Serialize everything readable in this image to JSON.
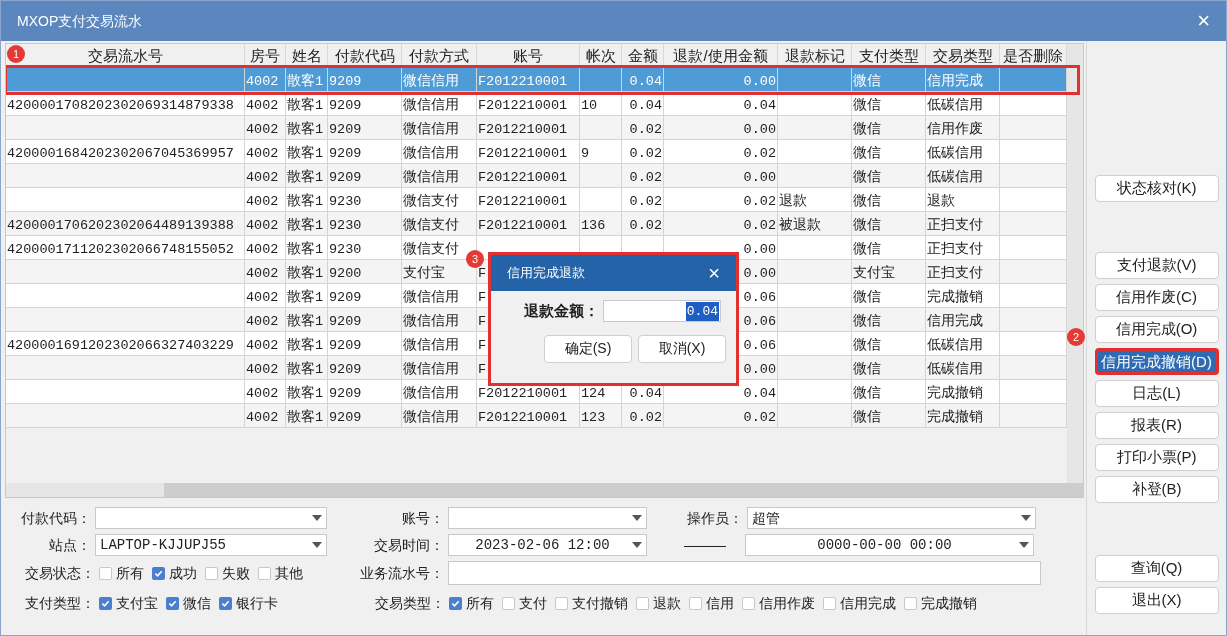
{
  "window": {
    "title": "MXOP支付交易流水",
    "close": "×"
  },
  "table": {
    "columns": [
      "交易流水号",
      "房号",
      "姓名",
      "付款代码",
      "付款方式",
      "账号",
      "帐次",
      "金额",
      "退款/使用金额",
      "退款标记",
      "支付类型",
      "交易类型",
      "是否删除"
    ],
    "rows": [
      {
        "selected": true,
        "cells": [
          "",
          "4002",
          "散客1",
          "9209",
          "微信信用",
          "F2012210001",
          "",
          "0.04",
          "0.00",
          "",
          "微信",
          "信用完成",
          ""
        ]
      },
      {
        "selected": false,
        "cells": [
          "4200001708202302069314879338",
          "4002",
          "散客1",
          "9209",
          "微信信用",
          "F2012210001",
          "10",
          "0.04",
          "0.04",
          "",
          "微信",
          "低碳信用",
          ""
        ]
      },
      {
        "selected": false,
        "cells": [
          "",
          "4002",
          "散客1",
          "9209",
          "微信信用",
          "F2012210001",
          "",
          "0.02",
          "0.00",
          "",
          "微信",
          "信用作废",
          ""
        ]
      },
      {
        "selected": false,
        "cells": [
          "4200001684202302067045369957",
          "4002",
          "散客1",
          "9209",
          "微信信用",
          "F2012210001",
          "9",
          "0.02",
          "0.02",
          "",
          "微信",
          "低碳信用",
          ""
        ]
      },
      {
        "selected": false,
        "cells": [
          "",
          "4002",
          "散客1",
          "9209",
          "微信信用",
          "F2012210001",
          "",
          "0.02",
          "0.00",
          "",
          "微信",
          "低碳信用",
          ""
        ]
      },
      {
        "selected": false,
        "cells": [
          "",
          "4002",
          "散客1",
          "9230",
          "微信支付",
          "F2012210001",
          "",
          "0.02",
          "0.02",
          "退款",
          "微信",
          "退款",
          ""
        ]
      },
      {
        "selected": false,
        "cells": [
          "4200001706202302064489139388",
          "4002",
          "散客1",
          "9230",
          "微信支付",
          "F2012210001",
          "136",
          "0.02",
          "0.02",
          "被退款",
          "微信",
          "正扫支付",
          ""
        ]
      },
      {
        "selected": false,
        "cells": [
          "4200001711202302066748155052",
          "4002",
          "散客1",
          "9230",
          "微信支付",
          "",
          "",
          "",
          "0.00",
          "",
          "微信",
          "正扫支付",
          ""
        ]
      },
      {
        "selected": false,
        "cells": [
          "",
          "4002",
          "散客1",
          "9200",
          "支付宝",
          "F",
          "",
          "",
          "0.00",
          "",
          "支付宝",
          "正扫支付",
          ""
        ]
      },
      {
        "selected": false,
        "cells": [
          "",
          "4002",
          "散客1",
          "9209",
          "微信信用",
          "F",
          "",
          "",
          "0.06",
          "",
          "微信",
          "完成撤销",
          ""
        ]
      },
      {
        "selected": false,
        "cells": [
          "",
          "4002",
          "散客1",
          "9209",
          "微信信用",
          "F",
          "",
          "",
          "0.06",
          "",
          "微信",
          "信用完成",
          ""
        ]
      },
      {
        "selected": false,
        "cells": [
          "4200001691202302066327403229",
          "4002",
          "散客1",
          "9209",
          "微信信用",
          "F",
          "",
          "",
          "0.06",
          "",
          "微信",
          "低碳信用",
          ""
        ]
      },
      {
        "selected": false,
        "cells": [
          "",
          "4002",
          "散客1",
          "9209",
          "微信信用",
          "F",
          "",
          "",
          "0.00",
          "",
          "微信",
          "低碳信用",
          ""
        ]
      },
      {
        "selected": false,
        "cells": [
          "",
          "4002",
          "散客1",
          "9209",
          "微信信用",
          "F2012210001",
          "124",
          "0.04",
          "0.04",
          "",
          "微信",
          "完成撤销",
          ""
        ]
      },
      {
        "selected": false,
        "cells": [
          "",
          "4002",
          "散客1",
          "9209",
          "微信信用",
          "F2012210001",
          "123",
          "0.02",
          "0.02",
          "",
          "微信",
          "完成撤销",
          ""
        ]
      }
    ]
  },
  "dialog": {
    "title": "信用完成退款",
    "close": "×",
    "label": "退款金额：",
    "value": "0.04",
    "buttons": [
      "确定(S)",
      "取消(X)"
    ]
  },
  "side_buttons": [
    {
      "items": [
        {
          "label": "状态核对(K)",
          "focused": false
        }
      ]
    },
    {
      "items": [
        {
          "label": "支付退款(V)",
          "focused": false
        },
        {
          "label": "信用作废(C)",
          "focused": false
        },
        {
          "label": "信用完成(O)",
          "focused": false
        },
        {
          "label": "信用完成撤销(D)",
          "focused": true
        },
        {
          "label": "日志(L)",
          "focused": false
        },
        {
          "label": "报表(R)",
          "focused": false
        },
        {
          "label": "打印小票(P)",
          "focused": false
        },
        {
          "label": "补登(B)",
          "focused": false
        }
      ]
    },
    {
      "items": [
        {
          "label": "查询(Q)",
          "focused": false
        },
        {
          "label": "退出(X)",
          "focused": false
        }
      ]
    }
  ],
  "fields": [
    {
      "label": "付款代码："
    },
    {
      "label": "账号："
    },
    {
      "label": "操作员：",
      "value": "超管"
    },
    {
      "label": "站点：",
      "value": "LAPTOP-KJJUPJ55"
    },
    {
      "label": "交易时间：",
      "value": "2023-02-06 12:00",
      "separator": "———",
      "value_to": "0000-00-00 00:00"
    }
  ],
  "status": {
    "label": "交易状态：",
    "options": [
      {
        "label": "所有",
        "checked": false
      },
      {
        "label": "成功",
        "checked": true
      },
      {
        "label": "失败",
        "checked": false
      },
      {
        "label": "其他",
        "checked": false
      }
    ]
  },
  "serial": {
    "label": "业务流水号："
  },
  "pay_types": {
    "label": "支付类型：",
    "options": [
      {
        "label": "支付宝",
        "checked": true
      },
      {
        "label": "微信",
        "checked": true
      },
      {
        "label": "银行卡",
        "checked": true
      }
    ]
  },
  "trade_types": {
    "label": "交易类型：",
    "options": [
      {
        "label": "所有",
        "checked": true
      },
      {
        "label": "支付",
        "checked": false
      },
      {
        "label": "支付撤销",
        "checked": false
      },
      {
        "label": "退款",
        "checked": false
      },
      {
        "label": "信用",
        "checked": false
      },
      {
        "label": "信用作废",
        "checked": false
      },
      {
        "label": "信用完成",
        "checked": false
      },
      {
        "label": "完成撤销",
        "checked": false
      }
    ]
  },
  "annotations": [
    "1",
    "2",
    "3"
  ]
}
